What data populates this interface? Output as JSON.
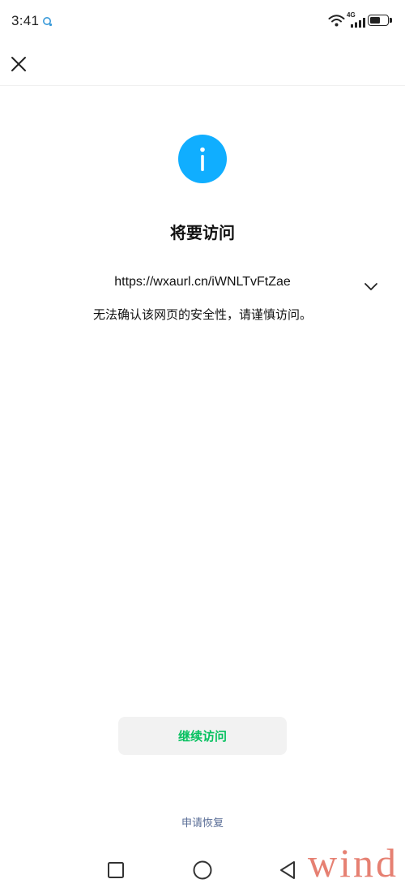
{
  "status_bar": {
    "time": "3:41",
    "network_label": "4G",
    "battery_level": 0.6,
    "icons": [
      "notification-icon",
      "wifi-icon",
      "signal-icon",
      "battery-icon"
    ]
  },
  "header": {
    "close_icon": "close-icon"
  },
  "main": {
    "icon": "info-icon",
    "title": "将要访问",
    "url": "https://wxaurl.cn/iWNLTvFtZae",
    "expand_icon": "chevron-down-icon",
    "warning": "无法确认该网页的安全性，请谨慎访问。"
  },
  "actions": {
    "continue_label": "继续访问",
    "restore_label": "申请恢复"
  },
  "nav_bar": {
    "icons": [
      "recent-apps-icon",
      "home-icon",
      "back-icon"
    ]
  },
  "watermark": "wind",
  "colors": {
    "accent": "#10aeff",
    "button_text": "#07c160",
    "link": "#576b95",
    "watermark": "#e0614f"
  }
}
